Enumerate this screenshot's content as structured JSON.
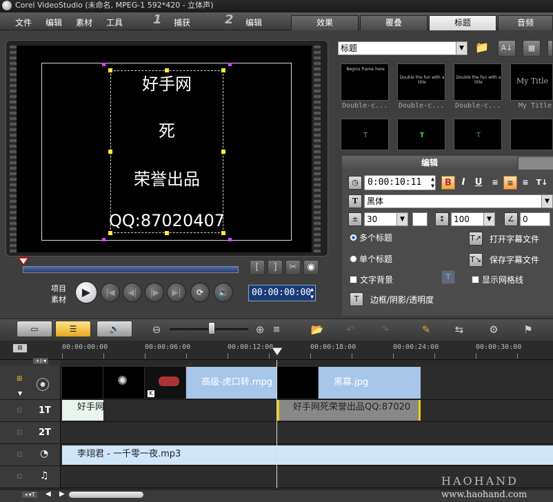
{
  "window": {
    "title": "Corel VideoStudio (未命名, MPEG-1 592*420 - 立体声)"
  },
  "menu": [
    "文件",
    "编辑",
    "素材",
    "工具"
  ],
  "steps": [
    {
      "num": "1",
      "label": "捕获"
    },
    {
      "num": "2",
      "label": "编辑"
    }
  ],
  "tabs": [
    {
      "label": "效果"
    },
    {
      "label": "覆叠"
    },
    {
      "label": "标题"
    },
    {
      "label": "音频"
    }
  ],
  "preview": {
    "title_lines": [
      "好手网",
      "死",
      "荣誉出品",
      "QQ:87020407"
    ],
    "project_label": "项目",
    "clip_label": "素材",
    "timecode": "00:00:00:00"
  },
  "library": {
    "category": "标题",
    "thumbnails": [
      {
        "caption": "Double-c...",
        "text": "Begins frame here"
      },
      {
        "caption": "Double-c...",
        "text": "Double the fun\nwith a title"
      },
      {
        "caption": "Double-c...",
        "text": "Double the fun\nwith a title"
      },
      {
        "caption": "My Title",
        "text": "My Title"
      },
      {
        "caption": "",
        "text": "T"
      },
      {
        "caption": "",
        "text": "T"
      },
      {
        "caption": "",
        "text": "T"
      },
      {
        "caption": "",
        "text": ""
      }
    ]
  },
  "edit": {
    "header": "编辑",
    "duration": "0:00:10:11",
    "font": "黑体",
    "font_size": "30",
    "line_spacing": "100",
    "rotation": "0",
    "multi_title": "多个标题",
    "single_title": "单个标题",
    "text_background": "文字背景",
    "open_subtitle": "打开字幕文件",
    "save_subtitle": "保存字幕文件",
    "show_grid": "显示网格线",
    "border_shadow": "边框/阴影/透明度"
  },
  "ruler": [
    "00:00:00:00",
    "00:00:06:00",
    "00:00:12:00",
    "00:00:18:00",
    "00:00:24:00",
    "00:00:30:00"
  ],
  "tracks": {
    "video_clip_1": "高级-虎口转.mpg",
    "video_clip_2": "黑幕.jpg",
    "title_clip_1": "好手网",
    "title_clip_2": "好手网死荣誉出品QQ:87020",
    "audio_clip": "李翊君 - 一千零一夜.mp3",
    "title_track_label": "1T",
    "title_track2_label": "2T"
  },
  "watermark": {
    "brand": "HAOHAND",
    "url": "www.haohand.com"
  }
}
